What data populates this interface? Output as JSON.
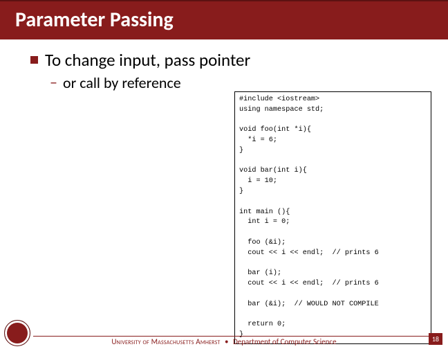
{
  "title": "Parameter Passing",
  "bullet": "To change input, pass pointer",
  "sub_bullet": "or call by reference",
  "code": "#include <iostream>\nusing namespace std;\n\nvoid foo(int *i){\n  *i = 6;\n}\n\nvoid bar(int i){\n  i = 10;\n}\n\nint main (){\n  int i = 0;\n\n  foo (&i);\n  cout << i << endl;  // prints 6\n\n  bar (i);\n  cout << i << endl;  // prints 6\n\n  bar (&i);  // WOULD NOT COMPILE\n\n  return 0;\n}",
  "footer": {
    "university": "University of Massachusetts Amherst",
    "separator": "•",
    "department": "Department of Computer Science"
  },
  "page_number": "18"
}
